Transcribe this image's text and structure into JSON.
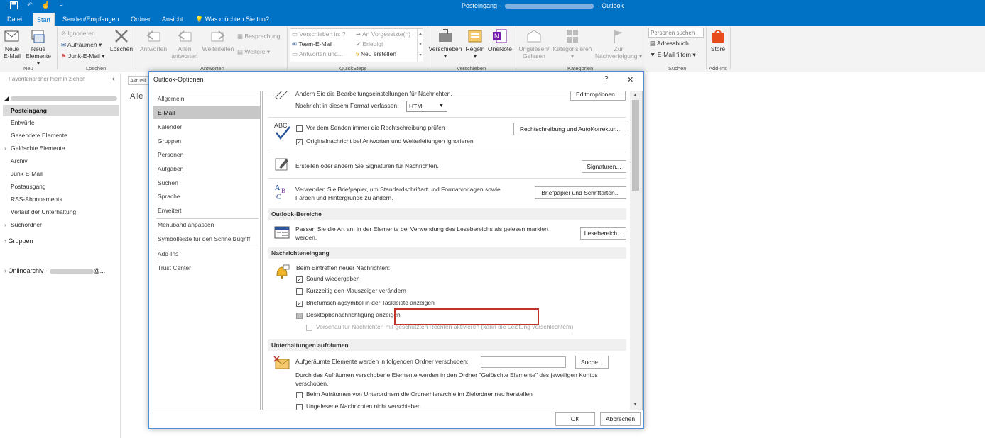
{
  "titlebar": {
    "folder": "Posteingang",
    "separator": "-",
    "app": "Outlook"
  },
  "tabs": [
    {
      "label": "Datei"
    },
    {
      "label": "Start"
    },
    {
      "label": "Senden/Empfangen"
    },
    {
      "label": "Ordner"
    },
    {
      "label": "Ansicht"
    },
    {
      "label": "Was möchten Sie tun?"
    }
  ],
  "ribbon": {
    "neu": {
      "mail_line1": "Neue",
      "mail_line2": "E-Mail",
      "items_line1": "Neue",
      "items_line2": "Elemente",
      "label": "Neu"
    },
    "loeschen": {
      "ignore": "Ignorieren",
      "cleanup": "Aufräumen",
      "junk": "Junk-E-Mail",
      "delete": "Löschen",
      "label": "Löschen"
    },
    "antworten": {
      "reply": "Antworten",
      "replyall_line1": "Allen",
      "replyall_line2": "antworten",
      "forward": "Weiterleiten",
      "meeting": "Besprechung",
      "more": "Weitere",
      "label": "Antworten"
    },
    "quicksteps": {
      "move": "Verschieben in: ?",
      "manager": "An Vorgesetzte(n)",
      "team": "Team-E-Mail",
      "done": "Erledigt",
      "replydel": "Antworten und...",
      "create": "Neu erstellen",
      "label": "QuickSteps"
    },
    "verschieben": {
      "move": "Verschieben",
      "rules": "Regeln",
      "onenote": "OneNote",
      "label": "Verschieben"
    },
    "kategorien": {
      "unread_line1": "Ungelesen/",
      "unread_line2": "Gelesen",
      "categorize": "Kategorisieren",
      "followup_line1": "Zur",
      "followup_line2": "Nachverfolgung",
      "label": "Kategorien"
    },
    "suchen": {
      "placeholder": "Personen suchen",
      "addressbook": "Adressbuch",
      "filter": "E-Mail filtern",
      "label": "Suchen"
    },
    "addins": {
      "store": "Store",
      "label": "Add-Ins"
    }
  },
  "nav": {
    "favorites_hint": "Favoritenordner hierhin ziehen",
    "folders": [
      "Posteingang",
      "Entwürfe",
      "Gesendete Elemente",
      "Gelöschte Elemente",
      "Archiv",
      "Junk-E-Mail",
      "Postausgang",
      "RSS-Abonnements",
      "Verlauf der Unterhaltung",
      "Suchordner"
    ],
    "groups": "Gruppen",
    "archive": "Onlinearchiv -",
    "archive_suffix": "@..."
  },
  "mainpane": {
    "search_stub": "Aktuell",
    "filter_all": "Alle"
  },
  "dialog": {
    "title": "Outlook-Optionen",
    "help": "?",
    "close": "✕",
    "categories": [
      "Allgemein",
      "E-Mail",
      "Kalender",
      "Gruppen",
      "Personen",
      "Aufgaben",
      "Suchen",
      "Sprache",
      "Erweitert",
      "Menüband anpassen",
      "Symbolleiste für den Schnellzugriff",
      "Add-Ins",
      "Trust Center"
    ],
    "content": {
      "edit_settings_text": "Ändern Sie die Bearbeitungseinstellungen für Nachrichten.",
      "editor_options_btn": "Editoroptionen...",
      "compose_format_label": "Nachricht in diesem Format verfassen:",
      "compose_format_value": "HTML",
      "spell_check_label": "Vor dem Senden immer die Rechtschreibung prüfen",
      "ignore_original_label": "Originalnachricht bei Antworten und Weiterleitungen ignorieren",
      "spelling_btn": "Rechtschreibung und AutoKorrektur...",
      "signatures_text": "Erstellen oder ändern Sie Signaturen für Nachrichten.",
      "signatures_btn": "Signaturen...",
      "stationery_text1": "Verwenden Sie Briefpapier, um Standardschriftart und Formatvorlagen sowie",
      "stationery_text2": "Farben und Hintergründe zu ändern.",
      "stationery_btn": "Briefpapier und Schriftarten...",
      "section_outlook_areas": "Outlook-Bereiche",
      "reading_pane_text1": "Passen Sie die Art an, in der Elemente bei Verwendung des Lesebereichs als gelesen markiert",
      "reading_pane_text2": "werden.",
      "reading_pane_btn": "Lesebereich...",
      "section_arrival": "Nachrichteneingang",
      "arrival_intro": "Beim Eintreffen neuer Nachrichten:",
      "play_sound": "Sound wiedergeben",
      "change_pointer": "Kurzzeitig den Mauszeiger verändern",
      "envelope_icon": "Briefumschlagsymbol in der Taskleiste anzeigen",
      "desktop_alert": "Desktopbenachrichtigung anzeigen",
      "preview_rights": "Vorschau für Nachrichten mit geschützten Rechten aktivieren (kann die Leistung verschlechtern)",
      "section_cleanup": "Unterhaltungen aufräumen",
      "cleanup_folder_label": "Aufgeräumte Elemente werden in folgenden Ordner verschoben:",
      "browse_btn": "Suche...",
      "cleanup_desc1": "Durch das Aufräumen verschobene Elemente werden in den Ordner \"Gelöschte Elemente\" des jeweiligen Kontos",
      "cleanup_desc2": "verschoben.",
      "keep_hierarchy": "Beim Aufräumen von Unterordnern die Ordnerhierarchie im Zielordner neu herstellen",
      "keep_unread": "Ungelesene Nachrichten nicht verschieben"
    },
    "ok": "OK",
    "cancel": "Abbrechen"
  },
  "colors": {
    "accent": "#0072c6",
    "highlight": "#c0332b"
  }
}
